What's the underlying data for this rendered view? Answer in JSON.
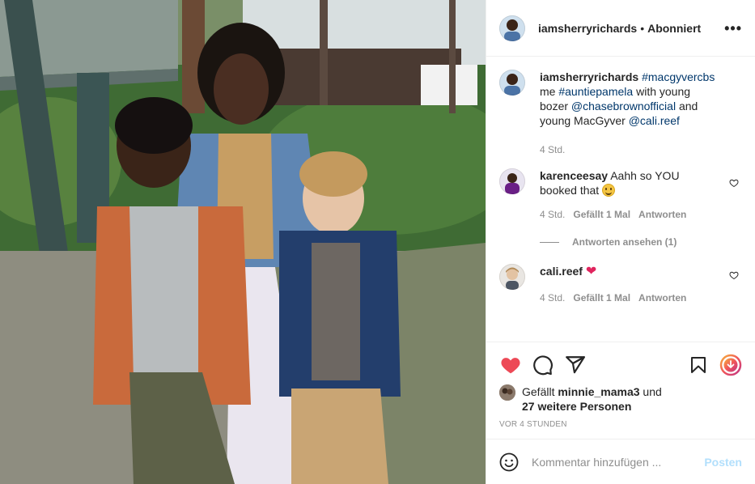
{
  "header": {
    "username": "iamsherryrichards",
    "separator": "•",
    "follow_status": "Abonniert",
    "more_icon": "more-horizontal-icon"
  },
  "caption": {
    "username": "iamsherryrichards",
    "parts": [
      {
        "text": "#macgyvercbs",
        "type": "tag"
      },
      {
        "text": " me ",
        "type": "text"
      },
      {
        "text": "#auntiepamela",
        "type": "tag"
      },
      {
        "text": " with young bozer ",
        "type": "text"
      },
      {
        "text": "@chasebrownofficial",
        "type": "tag"
      },
      {
        "text": " and young MacGyver ",
        "type": "text"
      },
      {
        "text": "@cali.reef",
        "type": "tag"
      }
    ],
    "time": "4 Std."
  },
  "comments": [
    {
      "username": "karenceesay",
      "text": "Aahh so YOU booked that",
      "emoji": "smiling-face-emoji",
      "time": "4 Std.",
      "likes": "Gefällt 1 Mal",
      "reply": "Antworten",
      "view_replies": "Antworten ansehen (1)"
    },
    {
      "username": "cali.reef",
      "text": "",
      "emoji": "red-heart-emoji",
      "heart_glyph": "❤",
      "time": "4 Std.",
      "likes": "Gefällt 1 Mal",
      "reply": "Antworten"
    }
  ],
  "actions": {
    "like_icon": "heart-filled-icon",
    "comment_icon": "comment-icon",
    "share_icon": "send-icon",
    "save_icon": "bookmark-icon",
    "download_icon": "download-icon",
    "like_color": "#ed4956"
  },
  "likes": {
    "prefix": "Gefällt",
    "user": "minnie_mama3",
    "conj": "und",
    "others": "27 weitere Personen"
  },
  "timestamp": "VOR 4 STUNDEN",
  "add_comment": {
    "placeholder": "Kommentar hinzufügen ...",
    "post_label": "Posten",
    "emoji_icon": "smiley-icon"
  },
  "colors": {
    "link": "#00376b",
    "muted": "#8e8e8e",
    "post_disabled": "#b2dffc"
  }
}
